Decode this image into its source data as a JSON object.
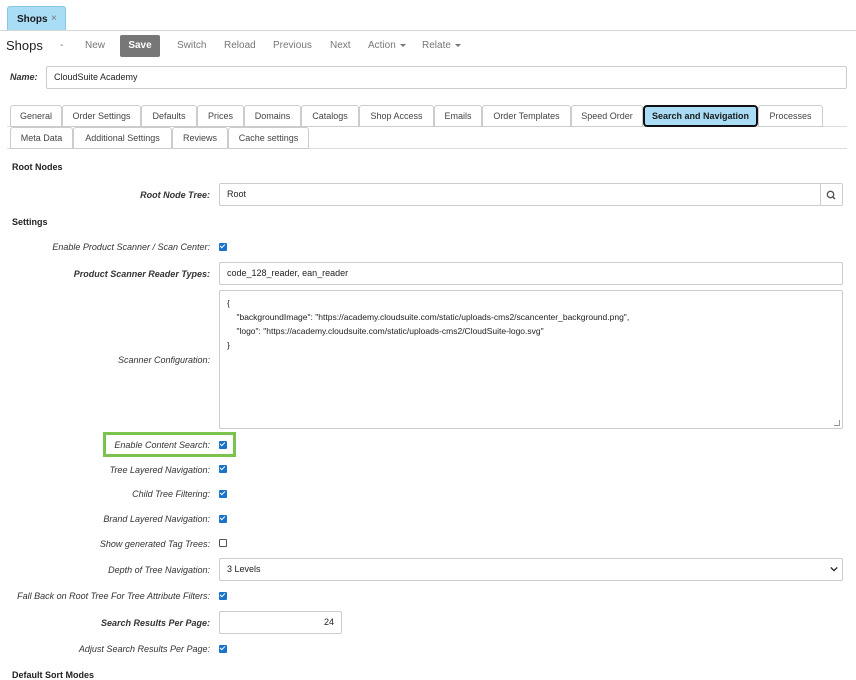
{
  "top_tab": {
    "label": "Shops",
    "close": "×"
  },
  "toolbar": {
    "title": "Shops",
    "dash": "-",
    "new": "New",
    "save": "Save",
    "switch": "Switch",
    "reload": "Reload",
    "previous": "Previous",
    "next": "Next",
    "action": "Action",
    "relate": "Relate"
  },
  "name": {
    "label": "Name:",
    "value": "CloudSuite Academy"
  },
  "tabs_row1": [
    "General",
    "Order Settings",
    "Defaults",
    "Prices",
    "Domains",
    "Catalogs",
    "Shop Access",
    "Emails",
    "Order Templates",
    "Speed Order",
    "Search and Navigation",
    "Processes"
  ],
  "tabs_row2": [
    "Meta Data",
    "Additional Settings",
    "Reviews",
    "Cache settings"
  ],
  "active_tab": "Search and Navigation",
  "sections": {
    "root_nodes": "Root Nodes",
    "settings": "Settings",
    "default_sort": "Default Sort Modes"
  },
  "fields": {
    "root_node_tree": {
      "label": "Root Node Tree:",
      "value": "Root"
    },
    "enable_scanner": {
      "label": "Enable Product Scanner / Scan Center:",
      "checked": true
    },
    "reader_types": {
      "label": "Product Scanner Reader Types:",
      "value": "code_128_reader, ean_reader"
    },
    "scanner_config": {
      "label": "Scanner Configuration:",
      "value": "{\n    \"backgroundImage\": \"https://academy.cloudsuite.com/static/uploads-cms2/scancenter_background.png\",\n    \"logo\": \"https://academy.cloudsuite.com/static/uploads-cms2/CloudSuite-logo.svg\"\n}"
    },
    "enable_content_search": {
      "label": "Enable Content Search:",
      "checked": true
    },
    "tree_layered_nav": {
      "label": "Tree Layered Navigation:",
      "checked": true
    },
    "child_tree_filtering": {
      "label": "Child Tree Filtering:",
      "checked": true
    },
    "brand_layered_nav": {
      "label": "Brand Layered Navigation:",
      "checked": true
    },
    "show_generated_tag_trees": {
      "label": "Show generated Tag Trees:",
      "checked": false
    },
    "depth_tree_nav": {
      "label": "Depth of Tree Navigation:",
      "value": "3 Levels"
    },
    "fallback_root_tree": {
      "label": "Fall Back on Root Tree For Tree Attribute Filters:",
      "checked": true
    },
    "results_per_page": {
      "label": "Search Results Per Page:",
      "value": "24"
    },
    "adjust_results_per_page": {
      "label": "Adjust Search Results Per Page:",
      "checked": true
    }
  },
  "colors": {
    "accent_tab": "#a9ddf5",
    "checkbox": "#1a73c8",
    "highlight": "#7cc24e",
    "save_button": "#777777"
  }
}
